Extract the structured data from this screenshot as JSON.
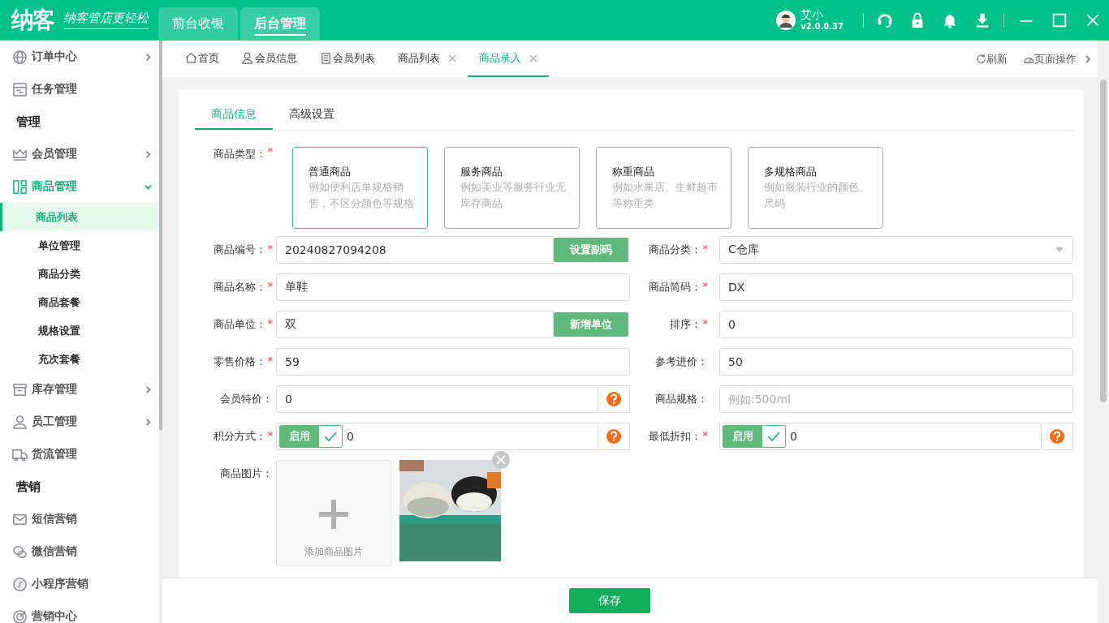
{
  "header": {
    "logo": "纳客",
    "slogan": "纳客管店更轻松",
    "top_tabs": [
      {
        "label": "前台收银",
        "selected": false
      },
      {
        "label": "后台管理",
        "selected": true
      }
    ],
    "user": {
      "name": "艾小",
      "version": "v2.0.0.37"
    }
  },
  "sidebar": {
    "items": [
      {
        "kind": "item",
        "label": "订单中心",
        "expanded": false
      },
      {
        "kind": "item",
        "label": "任务管理"
      },
      {
        "kind": "heading",
        "label": "管理"
      },
      {
        "kind": "item",
        "label": "会员管理",
        "expanded": false
      },
      {
        "kind": "item",
        "label": "商品管理",
        "expanded": true,
        "children": [
          {
            "label": "商品列表",
            "selected": true
          },
          {
            "label": "单位管理",
            "selected": false
          },
          {
            "label": "商品分类",
            "selected": false
          },
          {
            "label": "商品套餐",
            "selected": false
          },
          {
            "label": "规格设置",
            "selected": false
          },
          {
            "label": "充次套餐",
            "selected": false
          }
        ]
      },
      {
        "kind": "item",
        "label": "库存管理",
        "expanded": false
      },
      {
        "kind": "item",
        "label": "员工管理",
        "expanded": false
      },
      {
        "kind": "item",
        "label": "货流管理"
      },
      {
        "kind": "heading",
        "label": "营销"
      },
      {
        "kind": "item",
        "label": "短信营销"
      },
      {
        "kind": "item",
        "label": "微信营销"
      },
      {
        "kind": "item",
        "label": "小程序营销"
      },
      {
        "kind": "item",
        "label": "营销中心"
      }
    ]
  },
  "tabs": [
    {
      "label": "首页",
      "selected": false,
      "closable": false
    },
    {
      "label": "会员信息",
      "selected": false,
      "closable": false
    },
    {
      "label": "会员列表",
      "selected": false,
      "closable": false
    },
    {
      "label": "商品列表",
      "selected": false,
      "closable": true
    },
    {
      "label": "商品录入",
      "selected": true,
      "closable": true
    }
  ],
  "tab_actions": {
    "refresh": "刷新",
    "page_ops": "页面操作"
  },
  "form_tabs": [
    {
      "label": "商品信息",
      "selected": true
    },
    {
      "label": "高级设置",
      "selected": false
    }
  ],
  "product_type": {
    "label": "商品类型：",
    "required_mark": "*",
    "options": [
      {
        "title": "普通商品",
        "desc": "例如便利店单规格销售，不区分颜色等规格",
        "selected": true
      },
      {
        "title": "服务商品",
        "desc": "例如美业等服务行业无库存商品",
        "selected": false
      },
      {
        "title": "称重商品",
        "desc": "例如水果店、生鲜超市等称重类",
        "selected": false
      },
      {
        "title": "多规格商品",
        "desc": "例如服装行业的颜色、尺码",
        "selected": false
      }
    ]
  },
  "fields": [
    {
      "kind": "button",
      "label": "商品编号：",
      "required_mark": "*",
      "value": "20240827094208",
      "button": "设置副码"
    },
    {
      "kind": "select",
      "label": "商品分类：",
      "required_mark": "*",
      "value": "C仓库"
    },
    {
      "kind": "text",
      "label": "商品名称：",
      "required_mark": "*",
      "value": "单鞋"
    },
    {
      "kind": "text",
      "label": "商品简码：",
      "required_mark": "*",
      "value": "DX"
    },
    {
      "kind": "button",
      "label": "商品单位：",
      "required_mark": "*",
      "value": "双",
      "button": "新增单位"
    },
    {
      "kind": "text",
      "label": "排序：",
      "required_mark": "*",
      "value": "0"
    },
    {
      "kind": "text",
      "label": "零售价格：",
      "required_mark": "*",
      "value": "59"
    },
    {
      "kind": "text",
      "label": "参考进价：",
      "value": "50"
    },
    {
      "kind": "help",
      "label": "会员特价：",
      "value": "0"
    },
    {
      "kind": "text",
      "label": "商品规格：",
      "placeholder": "例如:500ml"
    },
    {
      "kind": "toggle",
      "label": "积分方式：",
      "required_mark": "*",
      "toggle": "启用",
      "on": true,
      "value": "0"
    },
    {
      "kind": "toggle",
      "label": "最低折扣：",
      "required_mark": "*",
      "toggle": "启用",
      "on": true,
      "value": "0"
    }
  ],
  "images": {
    "label": "商品图片：",
    "add": "添加商品图片"
  },
  "save": "保存"
}
